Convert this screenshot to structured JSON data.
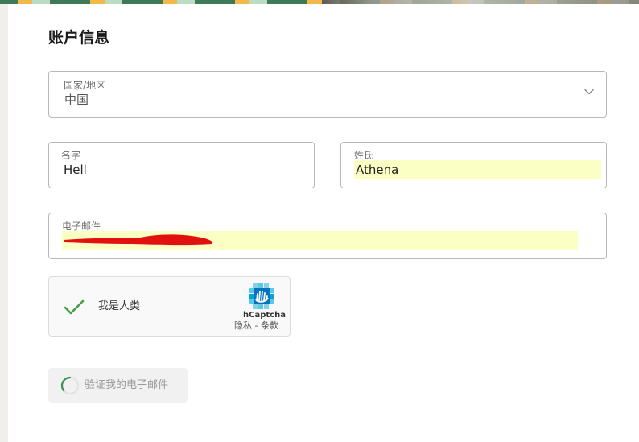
{
  "page": {
    "title": "账户信息"
  },
  "form": {
    "country": {
      "label": "国家/地区",
      "value": "中国"
    },
    "first_name": {
      "label": "名字",
      "value": "Hell"
    },
    "last_name": {
      "label": "姓氏",
      "value": "Athena"
    },
    "email": {
      "label": "电子邮件",
      "value": ""
    }
  },
  "captcha": {
    "checkbox_label": "我是人类",
    "brand": "hCaptcha",
    "links": "隐私 - 条款",
    "checked": true
  },
  "verify_button": {
    "label": "验证我的电子邮件"
  },
  "colors": {
    "autofill": "#fbffc4",
    "check_green": "#43a047",
    "redaction": "#e31010",
    "hcaptcha_teal": "#00a4d6"
  },
  "icons": {
    "dropdown": "chevron-down-icon",
    "captcha_check": "checkmark-icon",
    "captcha_logo": "hcaptcha-logo-icon",
    "loading": "loading-spinner-icon"
  }
}
